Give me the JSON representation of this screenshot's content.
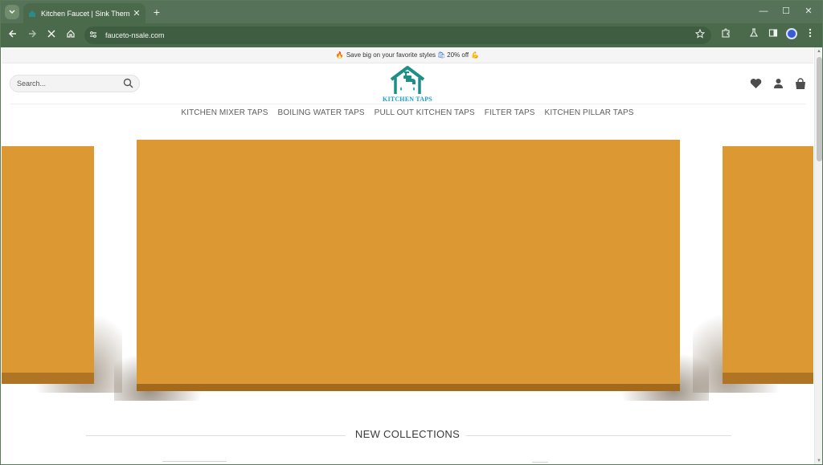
{
  "browser": {
    "tab_title": "Kitchen Faucet | Sink Thermost",
    "url": "fauceto-nsale.com",
    "tab_close": "✕",
    "new_tab": "+",
    "window_controls": {
      "minimize": "—",
      "maximize": "☐",
      "close": "✕"
    }
  },
  "site": {
    "promo": {
      "text_before": "Save big on your favorite styles",
      "text_after": "20% off"
    },
    "search_placeholder": "Search...",
    "logo_text": "KITCHEN TAPS",
    "nav": [
      "KITCHEN MIXER TAPS",
      "BOILING WATER TAPS",
      "PULL OUT KITCHEN TAPS",
      "FILTER TAPS",
      "KITCHEN PILLAR TAPS"
    ],
    "section_title": "NEW COLLECTIONS"
  },
  "colors": {
    "chrome": "#4b6a4c",
    "slide": "#dc9833",
    "logo": "#1c9ccf"
  },
  "icons": [
    "tab-search-icon",
    "back-icon",
    "forward-icon",
    "stop-icon",
    "home-icon",
    "site-info-icon",
    "bookmark-star-icon",
    "extensions-icon",
    "labs-icon",
    "side-panel-icon",
    "profile-icon",
    "menu-icon",
    "search-icon",
    "wishlist-heart-icon",
    "account-icon",
    "cart-bag-icon"
  ]
}
